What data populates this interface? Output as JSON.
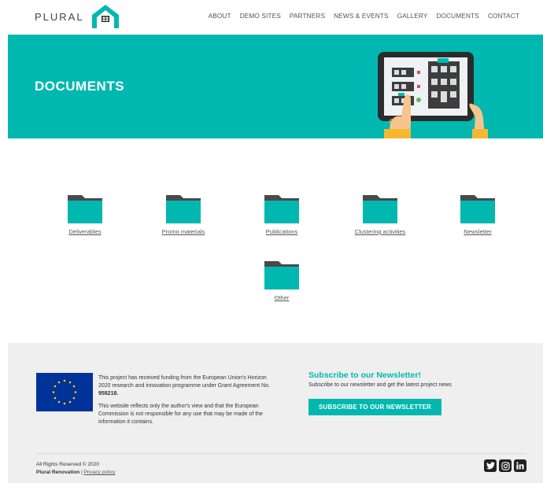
{
  "header": {
    "logo_text": "PLURAL",
    "nav": [
      "ABOUT",
      "DEMO SITES",
      "PARTNERS",
      "NEWS & EVENTS",
      "GALLERY",
      "DOCUMENTS",
      "CONTACT"
    ]
  },
  "hero": {
    "title": "DOCUMENTS"
  },
  "documents": [
    {
      "label": "Deliverables",
      "icon": "folder-icon"
    },
    {
      "label": "Promo materials",
      "icon": "folder-icon"
    },
    {
      "label": "Publications",
      "icon": "folder-icon"
    },
    {
      "label": "Clustering activities",
      "icon": "folder-icon"
    },
    {
      "label": "Newsletter",
      "icon": "folder-icon"
    },
    {
      "label": "Other",
      "icon": "folder-icon"
    }
  ],
  "footer": {
    "funding_line1": "This project has received funding from the European Union's Horizon 2020 research and innovation programme under Grant Agreement No. ",
    "grant_number": "958218.",
    "disclaimer": "This website reflects only the author's view and that the European Commission is not responsible for any use that may be made of the information it contains.",
    "subscribe_title": "Subscribe to our Newsletter!",
    "subscribe_desc": "Subscribe to our newsletter and get the latest project news",
    "subscribe_button": "SUBSCRIBE TO OUR NEWSLETTER",
    "rights": "All Rights Reserved © 2020",
    "company": "Plural Renovation",
    "separator": "|",
    "privacy": "Privacy policy",
    "socials": [
      "twitter-icon",
      "instagram-icon",
      "linkedin-icon"
    ]
  },
  "colors": {
    "accent": "#00b8b0",
    "folder_tab": "#4a4a4a",
    "eu_blue": "#003399",
    "eu_star": "#ffcc00"
  }
}
